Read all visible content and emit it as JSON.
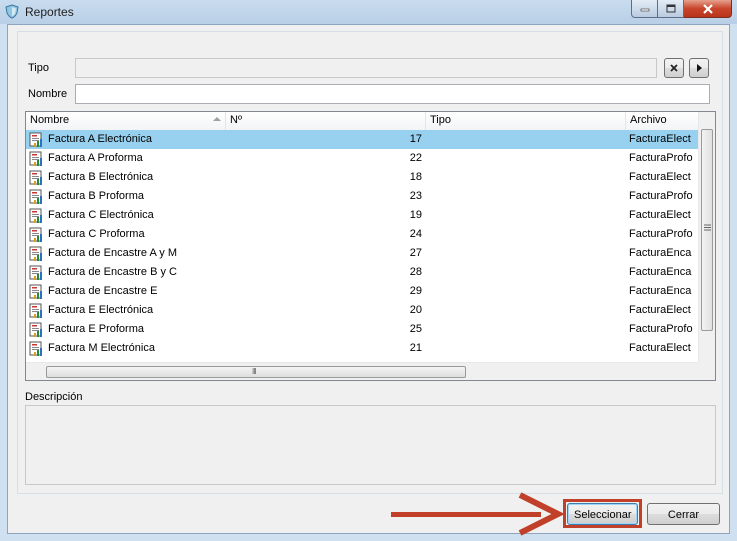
{
  "window": {
    "title": "Reportes"
  },
  "form": {
    "tipo_label": "Tipo",
    "tipo_value": "",
    "nombre_label": "Nombre",
    "nombre_value": ""
  },
  "list": {
    "columns": [
      {
        "label": "Nombre",
        "sorted": "ascending"
      },
      {
        "label": "Nº"
      },
      {
        "label": "Tipo"
      },
      {
        "label": "Archivo"
      }
    ],
    "rows": [
      {
        "nombre": "Factura A Electrónica",
        "num": "17",
        "tipo": "",
        "archivo": "FacturaElect",
        "selected": true
      },
      {
        "nombre": "Factura A Proforma",
        "num": "22",
        "tipo": "",
        "archivo": "FacturaProfo"
      },
      {
        "nombre": "Factura B Electrónica",
        "num": "18",
        "tipo": "",
        "archivo": "FacturaElect"
      },
      {
        "nombre": "Factura B Proforma",
        "num": "23",
        "tipo": "",
        "archivo": "FacturaProfo"
      },
      {
        "nombre": "Factura C Electrónica",
        "num": "19",
        "tipo": "",
        "archivo": "FacturaElect"
      },
      {
        "nombre": "Factura C Proforma",
        "num": "24",
        "tipo": "",
        "archivo": "FacturaProfo"
      },
      {
        "nombre": "Factura de Encastre A y M",
        "num": "27",
        "tipo": "",
        "archivo": "FacturaEnca"
      },
      {
        "nombre": "Factura de Encastre B y C",
        "num": "28",
        "tipo": "",
        "archivo": "FacturaEnca"
      },
      {
        "nombre": "Factura de Encastre E",
        "num": "29",
        "tipo": "",
        "archivo": "FacturaEnca"
      },
      {
        "nombre": "Factura E Electrónica",
        "num": "20",
        "tipo": "",
        "archivo": "FacturaElect"
      },
      {
        "nombre": "Factura E Proforma",
        "num": "25",
        "tipo": "",
        "archivo": "FacturaProfo"
      },
      {
        "nombre": "Factura M Electrónica",
        "num": "21",
        "tipo": "",
        "archivo": "FacturaElect"
      }
    ],
    "hscroll_grip": "III"
  },
  "description": {
    "label": "Descripción",
    "value": ""
  },
  "buttons": {
    "select_label": "Seleccionar",
    "close_label": "Cerrar"
  },
  "colors": {
    "selection": "#98d1ef",
    "annotation": "#c0402a"
  }
}
